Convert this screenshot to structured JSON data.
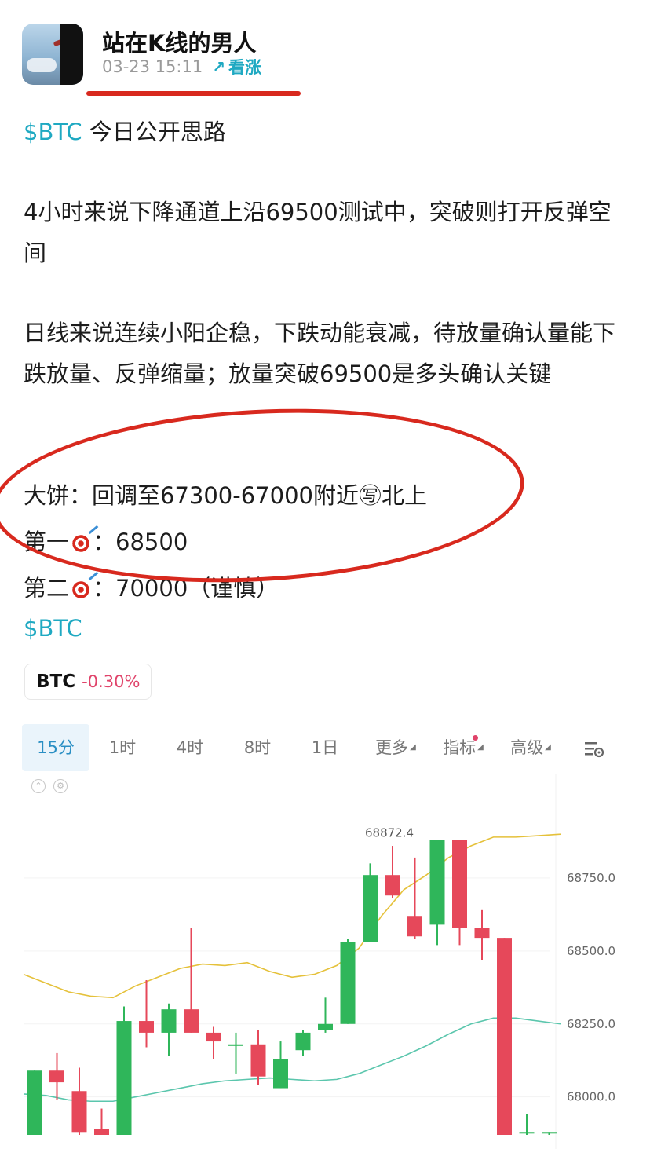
{
  "post": {
    "author": "站在K线的男人",
    "timestamp": "03-23 15:11",
    "sentiment_arrow": "↗",
    "sentiment": "看涨",
    "ticker_tag": "$BTC",
    "title_rest": " 今日公开思路",
    "para1": "4小时来说下降通道上沿69500测试中，突破则打开反弹空间",
    "para2": "日线来说连续小阳企稳，下跌动能衰减，待放量确认量能下跌放量、反弹缩量；放量突破69500是多头确认关键",
    "line_dabing": "大饼：回调至67300-67000附近㊢北上",
    "target1_prefix": "第一",
    "target1_value": "：68500",
    "target2_prefix": "第二",
    "target2_value": "：70000（谨慎）",
    "ticker_tag_end": "$BTC"
  },
  "badge": {
    "symbol": "BTC",
    "change": "-0.30%"
  },
  "tabs": [
    {
      "label": "15分",
      "active": true
    },
    {
      "label": "1时"
    },
    {
      "label": "4时"
    },
    {
      "label": "8时"
    },
    {
      "label": "1日"
    },
    {
      "label": "更多"
    },
    {
      "label": "指标"
    },
    {
      "label": "高级"
    }
  ],
  "colors": {
    "accent": "#1fa9c2",
    "up": "#2fb65a",
    "down": "#e6485a",
    "annotation": "#d8291e",
    "ma_short": "#e5c13a",
    "ma_long": "#5bc6ad"
  },
  "chart_data": {
    "type": "candlestick",
    "interval": "15分",
    "high_label": "68872.4",
    "y_ticks": [
      "68750.0",
      "68500.0",
      "68250.0",
      "68000.0"
    ],
    "y_tick_values": [
      68750,
      68500,
      68250,
      68000
    ],
    "ylim": [
      67870,
      69000
    ],
    "candles": [
      {
        "o": 67870,
        "c": 68090,
        "h": 68090,
        "l": 67870
      },
      {
        "o": 68090,
        "c": 68050,
        "h": 68150,
        "l": 67990
      },
      {
        "o": 68020,
        "c": 67880,
        "h": 68100,
        "l": 67870
      },
      {
        "o": 67890,
        "c": 67870,
        "h": 67960,
        "l": 67870
      },
      {
        "o": 67870,
        "c": 68260,
        "h": 68310,
        "l": 67870
      },
      {
        "o": 68260,
        "c": 68220,
        "h": 68400,
        "l": 68170
      },
      {
        "o": 68220,
        "c": 68300,
        "h": 68320,
        "l": 68140
      },
      {
        "o": 68300,
        "c": 68220,
        "h": 68580,
        "l": 68220
      },
      {
        "o": 68220,
        "c": 68190,
        "h": 68240,
        "l": 68130
      },
      {
        "o": 68180,
        "c": 68180,
        "h": 68220,
        "l": 68080
      },
      {
        "o": 68180,
        "c": 68070,
        "h": 68230,
        "l": 68040
      },
      {
        "o": 68030,
        "c": 68130,
        "h": 68190,
        "l": 68030
      },
      {
        "o": 68160,
        "c": 68220,
        "h": 68230,
        "l": 68140
      },
      {
        "o": 68230,
        "c": 68250,
        "h": 68340,
        "l": 68220
      },
      {
        "o": 68250,
        "c": 68530,
        "h": 68540,
        "l": 68250
      },
      {
        "o": 68530,
        "c": 68760,
        "h": 68800,
        "l": 68530
      },
      {
        "o": 68760,
        "c": 68690,
        "h": 68860,
        "l": 68680
      },
      {
        "o": 68620,
        "c": 68550,
        "h": 68820,
        "l": 68540
      },
      {
        "o": 68590,
        "c": 68880,
        "h": 68880,
        "l": 68520
      },
      {
        "o": 68880,
        "c": 68580,
        "h": 68880,
        "l": 68520
      },
      {
        "o": 68580,
        "c": 68545,
        "h": 68640,
        "l": 68470
      },
      {
        "o": 68545,
        "c": 67870,
        "h": 68545,
        "l": 67870
      },
      {
        "o": 67880,
        "c": 67880,
        "h": 67940,
        "l": 67870
      },
      {
        "o": 67880,
        "c": 67880,
        "h": 67880,
        "l": 67870
      }
    ],
    "ma_short": [
      68420,
      68390,
      68360,
      68345,
      68340,
      68380,
      68410,
      68440,
      68455,
      68450,
      68460,
      68430,
      68410,
      68420,
      68450,
      68510,
      68620,
      68710,
      68760,
      68820,
      68860,
      68890,
      68890,
      68895,
      68900
    ],
    "ma_long": [
      68010,
      68005,
      67990,
      67985,
      67985,
      68000,
      68015,
      68030,
      68045,
      68055,
      68060,
      68065,
      68060,
      68055,
      68060,
      68080,
      68110,
      68140,
      68175,
      68215,
      68250,
      68270,
      68270,
      68260,
      68250
    ]
  }
}
